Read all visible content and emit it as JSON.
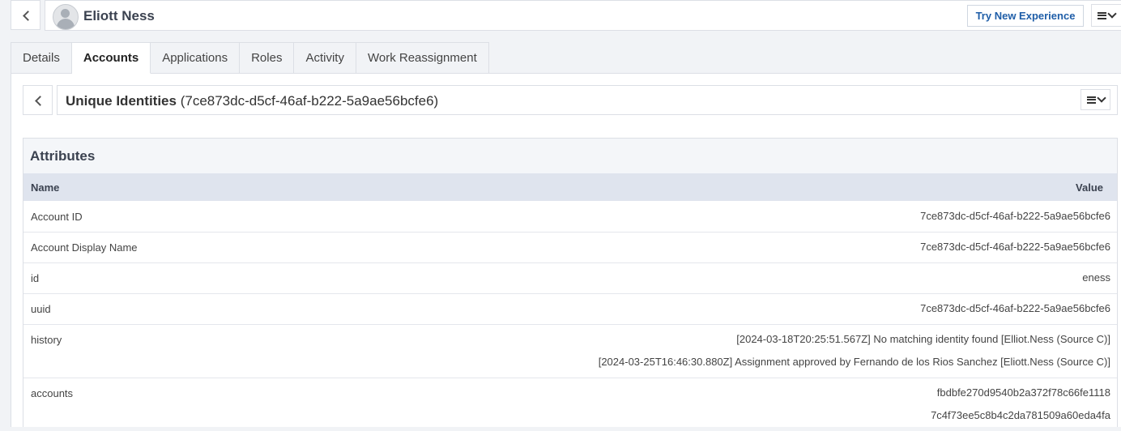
{
  "header": {
    "user_name": "Eliott Ness",
    "try_new_label": "Try New Experience"
  },
  "tabs": [
    {
      "label": "Details"
    },
    {
      "label": "Accounts",
      "active": true
    },
    {
      "label": "Applications"
    },
    {
      "label": "Roles"
    },
    {
      "label": "Activity"
    },
    {
      "label": "Work Reassignment"
    }
  ],
  "account": {
    "app_name": "Unique Identities",
    "id_text": "(7ce873dc-d5cf-46af-b222-5a9ae56bcfe6)"
  },
  "attributes": {
    "title": "Attributes",
    "col_name": "Name",
    "col_value": "Value",
    "rows": [
      {
        "name": "Account ID",
        "values": [
          "7ce873dc-d5cf-46af-b222-5a9ae56bcfe6"
        ]
      },
      {
        "name": "Account Display Name",
        "values": [
          "7ce873dc-d5cf-46af-b222-5a9ae56bcfe6"
        ]
      },
      {
        "name": "id",
        "values": [
          "eness"
        ]
      },
      {
        "name": "uuid",
        "values": [
          "7ce873dc-d5cf-46af-b222-5a9ae56bcfe6"
        ]
      },
      {
        "name": "history",
        "values": [
          "[2024-03-18T20:25:51.567Z] No matching identity found [Elliot.Ness (Source C)]",
          "[2024-03-25T16:46:30.880Z] Assignment approved by Fernando de los Rios Sanchez [Eliott.Ness (Source C)]"
        ]
      },
      {
        "name": "accounts",
        "values": [
          "fbdbfe270d9540b2a372f78c66fe1118",
          "7c4f73ee5c8b4c2da781509a60eda4fa"
        ]
      }
    ]
  },
  "icons": {
    "back": "chevron-left-icon",
    "menu": "menu-dropdown-icon",
    "avatar": "user-avatar-icon"
  }
}
